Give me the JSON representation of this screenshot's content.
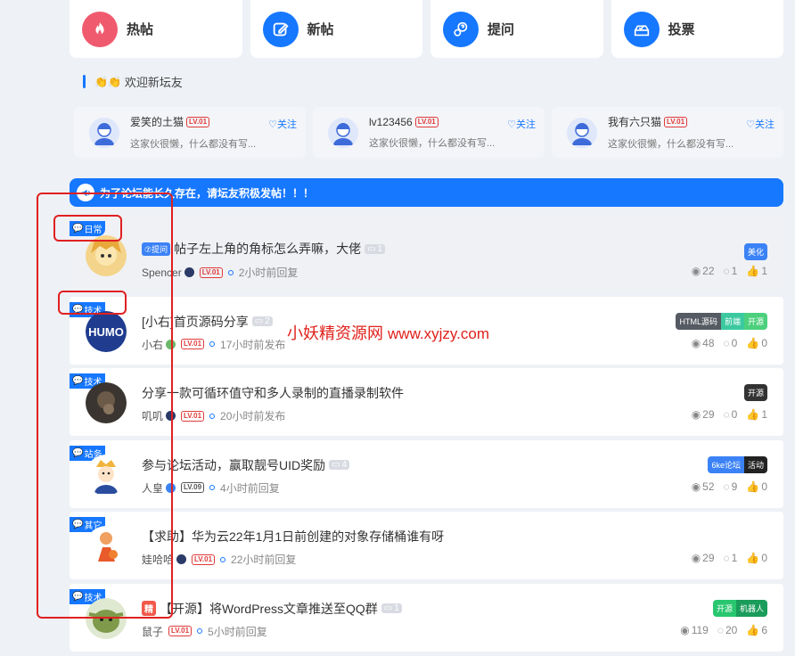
{
  "nav": [
    {
      "label": "热帖",
      "icon": "fire-icon",
      "color": "#f05a6e"
    },
    {
      "label": "新帖",
      "icon": "edit-icon",
      "color": "#1677ff"
    },
    {
      "label": "提问",
      "icon": "question-icon",
      "color": "#1677ff"
    },
    {
      "label": "投票",
      "icon": "vote-icon",
      "color": "#1677ff"
    }
  ],
  "welcome": {
    "title": "欢迎新坛友",
    "claps": "👏👏"
  },
  "new_users": [
    {
      "name": "爱笑的土猫",
      "level": "LV.01",
      "follow": "♡关注",
      "desc": "这家伙很懒，什么都没有写..."
    },
    {
      "name": "lv123456",
      "level": "LV.01",
      "follow": "♡关注",
      "desc": "这家伙很懒，什么都没有写..."
    },
    {
      "name": "我有六只猫",
      "level": "LV.01",
      "follow": "♡关注",
      "desc": "这家伙很懒，什么都没有写..."
    }
  ],
  "announcement": "为了论坛能长久存在，请坛友积极发帖！！！",
  "posts": [
    {
      "tag": "日常",
      "qa": "⑦提问",
      "jing": "",
      "title": "帖子左上角的角标怎么弄嘛，大佬",
      "images": "1",
      "author": "Spencer",
      "badge_color": "#2b3a67",
      "level": "LV.01",
      "time": "2小时前回复",
      "labels": [
        {
          "text": "美化",
          "color": "#3b82f6"
        }
      ],
      "views": "22",
      "comments": "1",
      "likes": "1"
    },
    {
      "tag": "技术",
      "qa": "",
      "jing": "",
      "title": "[小右]首页源码分享",
      "images": "2",
      "author": "小右",
      "badge_color": "#6bb86b",
      "level": "LV.01",
      "time": "17小时前发布",
      "labels": [
        {
          "text": "HTML源码",
          "color": "#555a63"
        },
        {
          "text": "前端",
          "color": "#3cc9a0"
        },
        {
          "text": "开源",
          "color": "#4cd07d"
        }
      ],
      "views": "48",
      "comments": "0",
      "likes": "0"
    },
    {
      "tag": "技术",
      "qa": "",
      "jing": "",
      "title": "分享一款可循环值守和多人录制的直播录制软件",
      "images": "",
      "author": "叽叽",
      "badge_color": "#2b3a67",
      "level": "LV.01",
      "time": "20小时前发布",
      "labels": [
        {
          "text": "开源",
          "color": "#333333"
        }
      ],
      "views": "29",
      "comments": "0",
      "likes": "1"
    },
    {
      "tag": "站务",
      "qa": "",
      "jing": "",
      "title": "参与论坛活动，赢取靓号UID奖励",
      "images": "4",
      "author": "人皇",
      "badge_color": "#3b82f6",
      "level": "LV.09",
      "time": "4小时前回复",
      "labels": [
        {
          "text": "6ke论坛",
          "color": "#3b82f6"
        },
        {
          "text": "活动",
          "color": "#222222"
        }
      ],
      "views": "52",
      "comments": "9",
      "likes": "0"
    },
    {
      "tag": "其它",
      "qa": "",
      "jing": "",
      "title": "【求助】华为云22年1月1日前创建的对象存储桶谁有呀",
      "images": "",
      "author": "娃哈哈",
      "badge_color": "#2b3a67",
      "level": "LV.01",
      "time": "22小时前回复",
      "labels": [],
      "views": "29",
      "comments": "1",
      "likes": "0"
    },
    {
      "tag": "技术",
      "qa": "",
      "jing": "精",
      "title": "【开源】将WordPress文章推送至QQ群",
      "images": "1",
      "author": "鼠子",
      "badge_color": "",
      "level": "LV.01",
      "time": "5小时前回复",
      "labels": [
        {
          "text": "开源",
          "color": "#28c76f"
        },
        {
          "text": "机器人",
          "color": "#1a9c5a"
        }
      ],
      "views": "119",
      "comments": "20",
      "likes": "6"
    }
  ],
  "watermark": {
    "text": "小妖精资源网",
    "url": "www.xyjzy.com"
  }
}
